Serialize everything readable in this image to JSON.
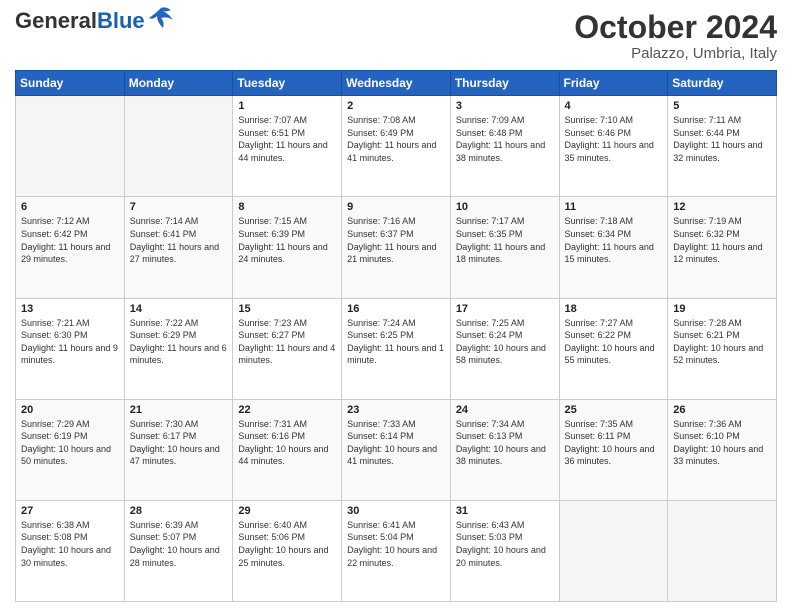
{
  "header": {
    "logo_general": "General",
    "logo_blue": "Blue",
    "month_title": "October 2024",
    "location": "Palazzo, Umbria, Italy"
  },
  "days_of_week": [
    "Sunday",
    "Monday",
    "Tuesday",
    "Wednesday",
    "Thursday",
    "Friday",
    "Saturday"
  ],
  "weeks": [
    [
      {
        "day": "",
        "info": ""
      },
      {
        "day": "",
        "info": ""
      },
      {
        "day": "1",
        "info": "Sunrise: 7:07 AM\nSunset: 6:51 PM\nDaylight: 11 hours and 44 minutes."
      },
      {
        "day": "2",
        "info": "Sunrise: 7:08 AM\nSunset: 6:49 PM\nDaylight: 11 hours and 41 minutes."
      },
      {
        "day": "3",
        "info": "Sunrise: 7:09 AM\nSunset: 6:48 PM\nDaylight: 11 hours and 38 minutes."
      },
      {
        "day": "4",
        "info": "Sunrise: 7:10 AM\nSunset: 6:46 PM\nDaylight: 11 hours and 35 minutes."
      },
      {
        "day": "5",
        "info": "Sunrise: 7:11 AM\nSunset: 6:44 PM\nDaylight: 11 hours and 32 minutes."
      }
    ],
    [
      {
        "day": "6",
        "info": "Sunrise: 7:12 AM\nSunset: 6:42 PM\nDaylight: 11 hours and 29 minutes."
      },
      {
        "day": "7",
        "info": "Sunrise: 7:14 AM\nSunset: 6:41 PM\nDaylight: 11 hours and 27 minutes."
      },
      {
        "day": "8",
        "info": "Sunrise: 7:15 AM\nSunset: 6:39 PM\nDaylight: 11 hours and 24 minutes."
      },
      {
        "day": "9",
        "info": "Sunrise: 7:16 AM\nSunset: 6:37 PM\nDaylight: 11 hours and 21 minutes."
      },
      {
        "day": "10",
        "info": "Sunrise: 7:17 AM\nSunset: 6:35 PM\nDaylight: 11 hours and 18 minutes."
      },
      {
        "day": "11",
        "info": "Sunrise: 7:18 AM\nSunset: 6:34 PM\nDaylight: 11 hours and 15 minutes."
      },
      {
        "day": "12",
        "info": "Sunrise: 7:19 AM\nSunset: 6:32 PM\nDaylight: 11 hours and 12 minutes."
      }
    ],
    [
      {
        "day": "13",
        "info": "Sunrise: 7:21 AM\nSunset: 6:30 PM\nDaylight: 11 hours and 9 minutes."
      },
      {
        "day": "14",
        "info": "Sunrise: 7:22 AM\nSunset: 6:29 PM\nDaylight: 11 hours and 6 minutes."
      },
      {
        "day": "15",
        "info": "Sunrise: 7:23 AM\nSunset: 6:27 PM\nDaylight: 11 hours and 4 minutes."
      },
      {
        "day": "16",
        "info": "Sunrise: 7:24 AM\nSunset: 6:25 PM\nDaylight: 11 hours and 1 minute."
      },
      {
        "day": "17",
        "info": "Sunrise: 7:25 AM\nSunset: 6:24 PM\nDaylight: 10 hours and 58 minutes."
      },
      {
        "day": "18",
        "info": "Sunrise: 7:27 AM\nSunset: 6:22 PM\nDaylight: 10 hours and 55 minutes."
      },
      {
        "day": "19",
        "info": "Sunrise: 7:28 AM\nSunset: 6:21 PM\nDaylight: 10 hours and 52 minutes."
      }
    ],
    [
      {
        "day": "20",
        "info": "Sunrise: 7:29 AM\nSunset: 6:19 PM\nDaylight: 10 hours and 50 minutes."
      },
      {
        "day": "21",
        "info": "Sunrise: 7:30 AM\nSunset: 6:17 PM\nDaylight: 10 hours and 47 minutes."
      },
      {
        "day": "22",
        "info": "Sunrise: 7:31 AM\nSunset: 6:16 PM\nDaylight: 10 hours and 44 minutes."
      },
      {
        "day": "23",
        "info": "Sunrise: 7:33 AM\nSunset: 6:14 PM\nDaylight: 10 hours and 41 minutes."
      },
      {
        "day": "24",
        "info": "Sunrise: 7:34 AM\nSunset: 6:13 PM\nDaylight: 10 hours and 38 minutes."
      },
      {
        "day": "25",
        "info": "Sunrise: 7:35 AM\nSunset: 6:11 PM\nDaylight: 10 hours and 36 minutes."
      },
      {
        "day": "26",
        "info": "Sunrise: 7:36 AM\nSunset: 6:10 PM\nDaylight: 10 hours and 33 minutes."
      }
    ],
    [
      {
        "day": "27",
        "info": "Sunrise: 6:38 AM\nSunset: 5:08 PM\nDaylight: 10 hours and 30 minutes."
      },
      {
        "day": "28",
        "info": "Sunrise: 6:39 AM\nSunset: 5:07 PM\nDaylight: 10 hours and 28 minutes."
      },
      {
        "day": "29",
        "info": "Sunrise: 6:40 AM\nSunset: 5:06 PM\nDaylight: 10 hours and 25 minutes."
      },
      {
        "day": "30",
        "info": "Sunrise: 6:41 AM\nSunset: 5:04 PM\nDaylight: 10 hours and 22 minutes."
      },
      {
        "day": "31",
        "info": "Sunrise: 6:43 AM\nSunset: 5:03 PM\nDaylight: 10 hours and 20 minutes."
      },
      {
        "day": "",
        "info": ""
      },
      {
        "day": "",
        "info": ""
      }
    ]
  ]
}
